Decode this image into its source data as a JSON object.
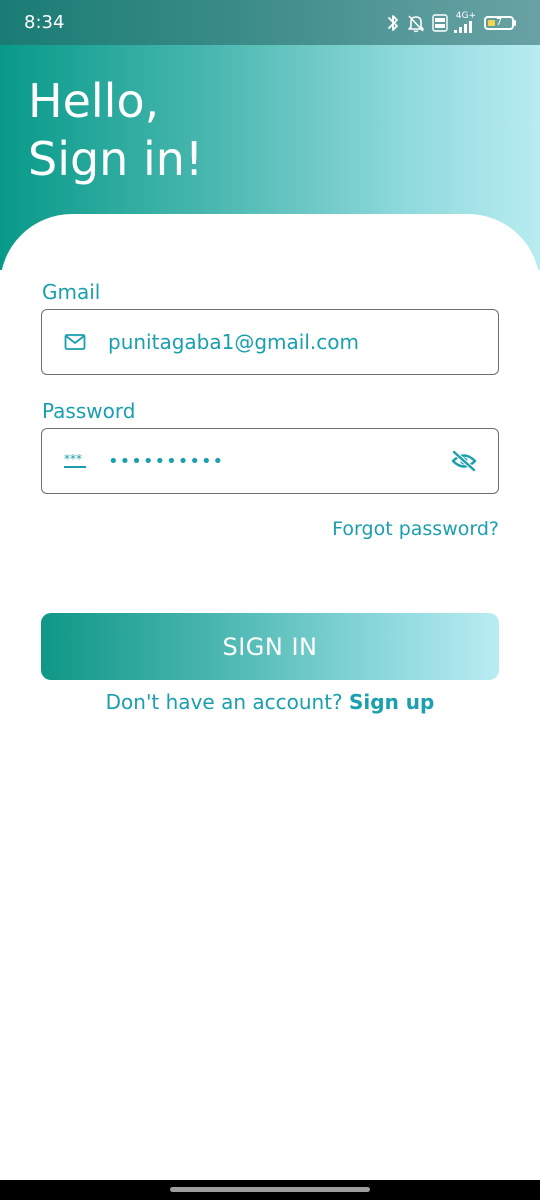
{
  "status_bar": {
    "time": "8:34",
    "network_label": "4G+",
    "volte_label": "Vo LTE",
    "battery_level": "7",
    "icons": [
      "bluetooth-icon",
      "notifications-off-icon",
      "volte-icon",
      "signal-icon",
      "battery-icon"
    ]
  },
  "header": {
    "greeting_line1": "Hello,",
    "greeting_line2": "Sign in!"
  },
  "form": {
    "email_label": "Gmail",
    "email_value": "punitagaba1@gmail.com",
    "email_icon": "mail-icon",
    "password_label": "Password",
    "password_value": "••••••••••",
    "password_icon": "password-icon",
    "password_toggle_icon": "eye-off-icon",
    "forgot_link": "Forgot password?"
  },
  "actions": {
    "signin_label": "SIGN IN",
    "signup_prompt": "Don't have an account? ",
    "signup_link": "Sign up"
  },
  "colors": {
    "accent": "#1a9fae",
    "gradient_start": "#089a89",
    "gradient_end": "#b8ecf1",
    "field_border": "#6f6f6f"
  }
}
